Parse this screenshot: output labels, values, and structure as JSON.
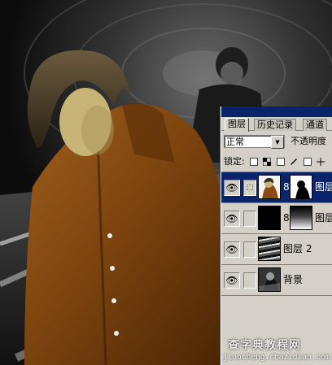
{
  "palette": {
    "tabs": [
      "图层",
      "历史记录",
      "通道"
    ],
    "blend_mode": "正常",
    "opacity_label": "不透明度",
    "lock_label": "锁定:",
    "layers": [
      {
        "name": "图层",
        "selected": true,
        "has_mask": true,
        "link_icon": true
      },
      {
        "name": "图层",
        "selected": false,
        "has_mask": true,
        "link_icon": false
      },
      {
        "name": "图层 2",
        "selected": false,
        "has_mask": false,
        "link_icon": false
      },
      {
        "name": "背景",
        "selected": false,
        "has_mask": false,
        "link_icon": false
      }
    ]
  },
  "watermark": {
    "line1": "查字典教程网",
    "line2": "jiaocheng.chazidian.com"
  },
  "colors": {
    "selection": "#0a246a",
    "panel": "#d4d0c8",
    "jacket": "#8a4c12"
  }
}
